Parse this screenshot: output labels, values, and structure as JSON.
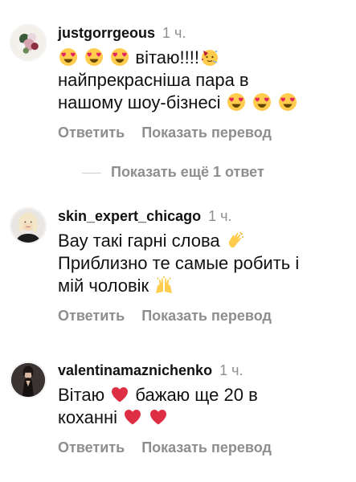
{
  "comments": [
    {
      "username": "justgorrgeous",
      "time": "1 ч.",
      "text_line1": "вітаю!!!!",
      "text_line2": "найпрекрасніша пара в",
      "text_line3": "нашому шоу-бізнесі",
      "avatar_icon": "flowers-bouquet-avatar",
      "emojis": [
        "smiling-face-with-heart-eyes",
        "smiling-face-with-heart-eyes",
        "smiling-face-with-heart-eyes",
        "partying-face",
        "smiling-face-with-heart-eyes",
        "smiling-face-with-heart-eyes",
        "smiling-face-with-heart-eyes"
      ]
    },
    {
      "username": "skin_expert_chicago",
      "time": "1 ч.",
      "text_line1": "Вау такі гарні слова",
      "text_line2": "Приблизно те самые робить і",
      "text_line3": "мій чоловік",
      "avatar_icon": "woman-portrait-avatar",
      "emojis": [
        "clapping-hands",
        "raising-hands"
      ]
    },
    {
      "username": "valentinamaznichenko",
      "time": "1 ч.",
      "text_line1": "Вітаю",
      "text_line1b": "бажаю ще 20 в",
      "text_line2": "коханні",
      "avatar_icon": "woman-dark-dress-avatar",
      "emojis": [
        "red-heart",
        "red-heart",
        "red-heart"
      ]
    }
  ],
  "actions": {
    "reply_label": "Ответить",
    "translate_label": "Показать перевод"
  },
  "more_replies_label": "Показать ещё 1 ответ",
  "colors": {
    "secondary_text": "#8e8e8e",
    "primary_text": "#111111",
    "heart": "#e0245e"
  }
}
